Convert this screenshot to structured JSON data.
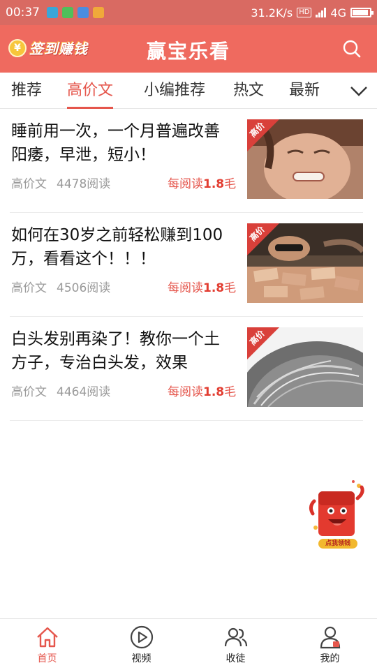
{
  "status_bar": {
    "time": "00:37",
    "speed": "31.2K/s",
    "hd": "HD",
    "network": "4G",
    "battery_level": 0.9
  },
  "header": {
    "checkin_label": "签到赚钱",
    "coin_symbol": "¥",
    "title": "赢宝乐看"
  },
  "tabs": [
    {
      "label": "推荐"
    },
    {
      "label": "高价文",
      "active": true
    },
    {
      "label": "小编推荐"
    },
    {
      "label": "热文"
    },
    {
      "label": "最新"
    }
  ],
  "articles": [
    {
      "title": "睡前用一次，一个月普遍改善阳痿，早泄，短小！",
      "category": "高价文",
      "reads": "4478阅读",
      "reward_prefix": "每阅读",
      "reward_value": "1.8",
      "reward_unit": "毛",
      "badge": "高价"
    },
    {
      "title": "如何在30岁之前轻松赚到100万，看看这个！！！",
      "category": "高价文",
      "reads": "4506阅读",
      "reward_prefix": "每阅读",
      "reward_value": "1.8",
      "reward_unit": "毛",
      "badge": "高价"
    },
    {
      "title": "白头发别再染了！教你一个土方子，专治白头发，效果",
      "category": "高价文",
      "reads": "4464阅读",
      "reward_prefix": "每阅读",
      "reward_value": "1.8",
      "reward_unit": "毛",
      "badge": "高价"
    }
  ],
  "floating_envelope": {
    "label": "点我领钱"
  },
  "bottom_nav": [
    {
      "label": "首页",
      "icon": "home-icon",
      "active": true
    },
    {
      "label": "视频",
      "icon": "play-icon"
    },
    {
      "label": "收徒",
      "icon": "users-icon"
    },
    {
      "label": "我的",
      "icon": "profile-icon"
    }
  ],
  "colors": {
    "primary": "#ef6a5f",
    "status_bar": "#d96a62",
    "accent": "#e5564c"
  }
}
